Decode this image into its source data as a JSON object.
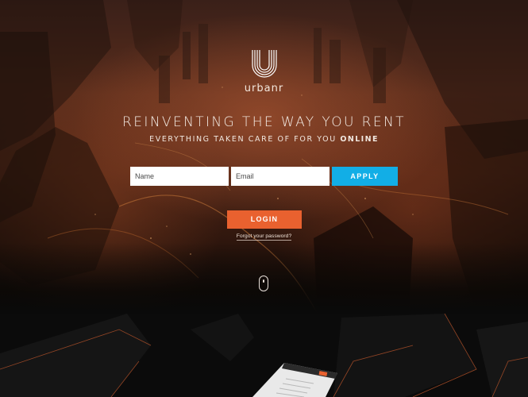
{
  "brand": {
    "name": "urbanr",
    "logo_icon": "urbanr-u-logo-icon"
  },
  "hero": {
    "headline": "REINVENTING THE WAY YOU RENT",
    "subline_prefix": "EVERYTHING TAKEN CARE OF FOR YOU",
    "subline_emphasis": "ONLINE"
  },
  "signup": {
    "name_placeholder": "Name",
    "email_placeholder": "Email",
    "apply_label": "APPLY"
  },
  "auth": {
    "login_label": "LOGIN",
    "forgot_label": "Forgot your password?"
  },
  "scroll_hint": {
    "icon": "mouse-scroll-icon"
  },
  "colors": {
    "accent_orange": "#e9612f",
    "accent_blue": "#12aee6",
    "dark_bg": "#0b0b0b"
  }
}
